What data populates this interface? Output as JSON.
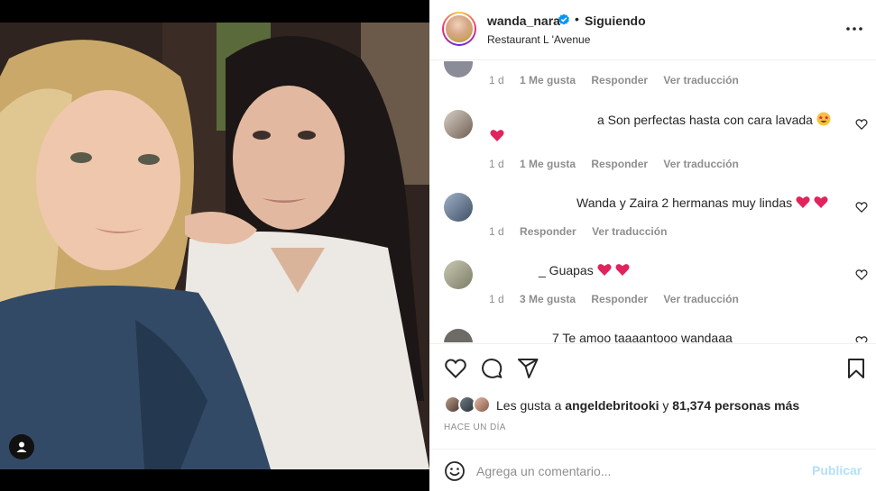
{
  "post": {
    "username": "wanda_nara",
    "separator": "•",
    "following_label": "Siguiendo",
    "location": "Restaurant L 'Avenue"
  },
  "comments": [
    {
      "text": "",
      "meta": {
        "age": "1 d",
        "likes": "1 Me gusta",
        "reply": "Responder",
        "translate": "Ver traducción"
      }
    },
    {
      "text": "a Son perfectas hasta con cara lavada",
      "meta": {
        "age": "1 d",
        "likes": "1 Me gusta",
        "reply": "Responder",
        "translate": "Ver traducción"
      }
    },
    {
      "text": "Wanda y Zaira 2 hermanas muy lindas",
      "meta": {
        "age": "1 d",
        "likes": "",
        "reply": "Responder",
        "translate": "Ver traducción"
      }
    },
    {
      "text": "_ Guapas",
      "meta": {
        "age": "1 d",
        "likes": "3 Me gusta",
        "reply": "Responder",
        "translate": "Ver traducción"
      }
    },
    {
      "text": "7 Te amoo taaaantooo wandaaa",
      "meta": {}
    }
  ],
  "likes": {
    "prefix": "Les gusta a",
    "user": "angeldebritooki",
    "joiner": "y",
    "count": "81,374 personas más"
  },
  "timestamp": "HACE UN DÍA",
  "composer": {
    "placeholder": "Agrega un comentario...",
    "publish_label": "Publicar"
  },
  "colors": {
    "verified": "#0095f6",
    "heart": "#ed4956",
    "publish_disabled": "#b2dffc",
    "muted": "#8e8e8e"
  },
  "icons": [
    "tag-user-icon",
    "verified-icon",
    "more-options-icon",
    "heart-icon",
    "comment-icon",
    "share-icon",
    "bookmark-icon",
    "emoji-icon"
  ]
}
